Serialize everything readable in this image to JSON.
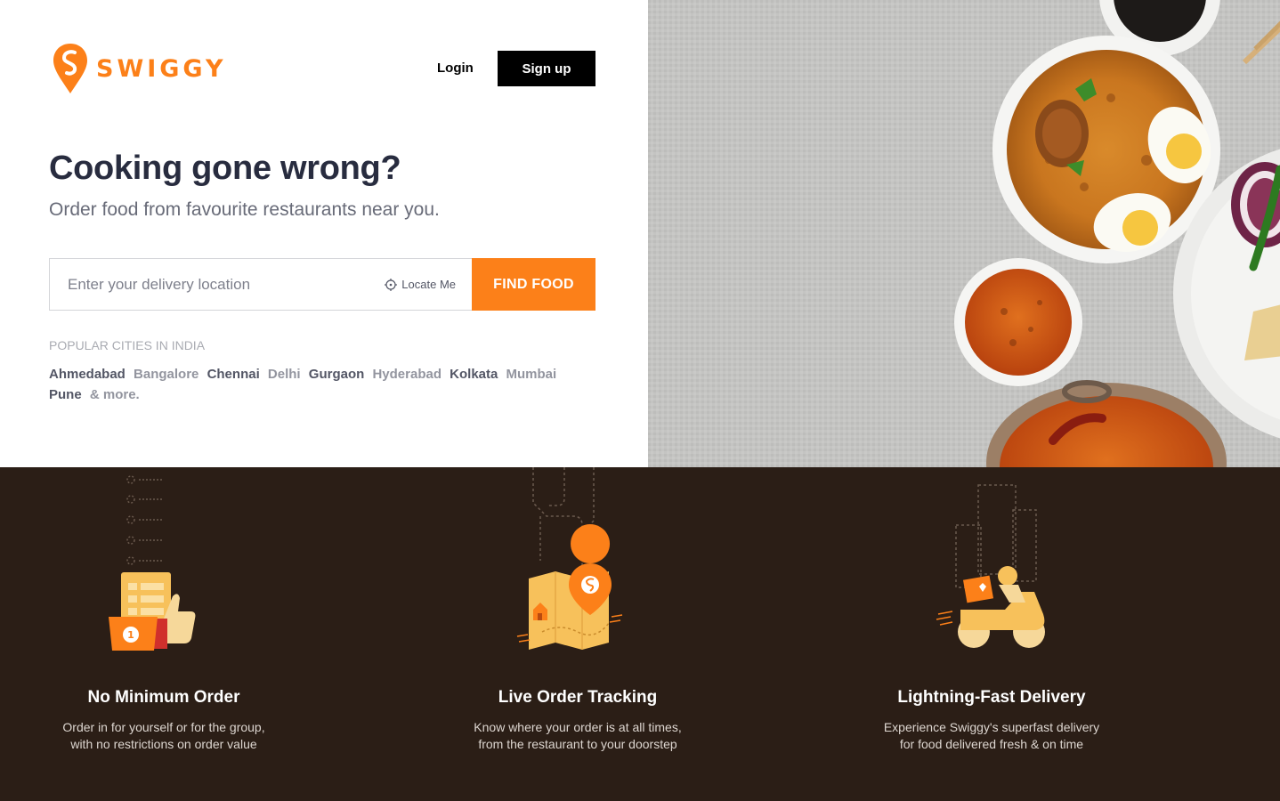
{
  "brand": {
    "name": "SWIGGY",
    "color": "#fc8019"
  },
  "nav": {
    "login_label": "Login",
    "signup_label": "Sign up"
  },
  "hero": {
    "headline": "Cooking gone wrong?",
    "subhead": "Order food from favourite restaurants near you.",
    "search": {
      "placeholder": "Enter your delivery location",
      "value": "",
      "locate_label": "Locate Me",
      "find_label": "FIND FOOD"
    }
  },
  "cities": {
    "title": "POPULAR CITIES IN INDIA",
    "items": [
      {
        "name": "Ahmedabad",
        "tone": "dark"
      },
      {
        "name": "Bangalore",
        "tone": "light"
      },
      {
        "name": "Chennai",
        "tone": "dark"
      },
      {
        "name": "Delhi",
        "tone": "light"
      },
      {
        "name": "Gurgaon",
        "tone": "dark"
      },
      {
        "name": "Hyderabad",
        "tone": "light"
      },
      {
        "name": "Kolkata",
        "tone": "dark"
      },
      {
        "name": "Mumbai",
        "tone": "light"
      },
      {
        "name": "Pune",
        "tone": "dark"
      }
    ],
    "more_label": "& more."
  },
  "features": {
    "background": "#2b1e16",
    "items": [
      {
        "icon": "order-list-thumbs-up-icon",
        "title": "No Minimum Order",
        "desc_line1": "Order in for yourself or for the group,",
        "desc_line2": "with no restrictions on order value"
      },
      {
        "icon": "map-pin-tracking-icon",
        "title": "Live Order Tracking",
        "desc_line1": "Know where your order is at all times,",
        "desc_line2": "from the restaurant to your doorstep"
      },
      {
        "icon": "delivery-scooter-icon",
        "title": "Lightning-Fast Delivery",
        "desc_line1": "Experience Swiggy's superfast delivery",
        "desc_line2": "for food delivered fresh & on time"
      }
    ]
  },
  "colors": {
    "accent": "#fc8019",
    "text_dark": "#282c3f",
    "text_muted": "#686b78"
  }
}
